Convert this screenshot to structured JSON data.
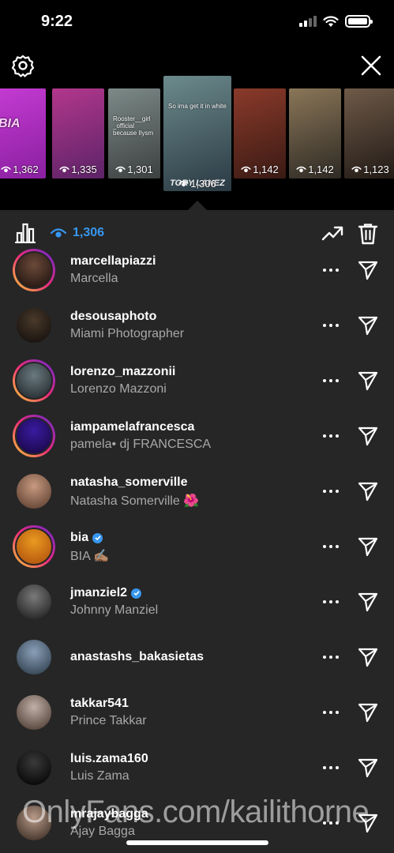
{
  "status_bar": {
    "time": "9:22"
  },
  "stories": [
    {
      "views": "1,362",
      "caption": "",
      "art": "BIA",
      "colors": [
        "#8a1fa0",
        "#c43bd2"
      ]
    },
    {
      "views": "1,335",
      "caption": "",
      "art": "",
      "colors": [
        "#5c2367",
        "#b2378c"
      ]
    },
    {
      "views": "1,301",
      "caption": "Rooster__girl _official because Ilysm",
      "art": "",
      "colors": [
        "#3c4040",
        "#7c8a88"
      ]
    },
    {
      "views": "1,306",
      "caption": "So ima get it in white",
      "art": "TORY LANEZ",
      "colors": [
        "#2a3a44",
        "#6c8a8c"
      ]
    },
    {
      "views": "1,142",
      "caption": "",
      "art": "",
      "colors": [
        "#3a1a14",
        "#8a3a2a"
      ]
    },
    {
      "views": "1,142",
      "caption": "",
      "art": "",
      "colors": [
        "#2e2a24",
        "#8a7658"
      ]
    },
    {
      "views": "1,123",
      "caption": "",
      "art": "",
      "colors": [
        "#221a16",
        "#6e5a48"
      ]
    }
  ],
  "toolbar": {
    "view_count": "1,306"
  },
  "viewers": [
    {
      "username": "marcellapiazzi",
      "fullname": "Marcella",
      "verified": false,
      "ring": true,
      "avatar_colors": [
        "#6b4a3a",
        "#2a1a14"
      ]
    },
    {
      "username": "desousaphoto",
      "fullname": "Miami Photographer",
      "verified": false,
      "ring": false,
      "avatar_colors": [
        "#4a3a2a",
        "#1a1410"
      ]
    },
    {
      "username": "lorenzo_mazzonii",
      "fullname": "Lorenzo Mazzoni",
      "verified": false,
      "ring": true,
      "avatar_colors": [
        "#6a7a80",
        "#2c3438"
      ]
    },
    {
      "username": "iampamelafrancesca",
      "fullname": "pamela• dj FRANCESCA",
      "verified": false,
      "ring": true,
      "avatar_colors": [
        "#3a1aa0",
        "#1c0a50"
      ]
    },
    {
      "username": "natasha_somerville",
      "fullname": "Natasha Somerville 🌺",
      "verified": false,
      "ring": false,
      "avatar_colors": [
        "#c89a80",
        "#6a4a3a"
      ]
    },
    {
      "username": "bia",
      "fullname": "BIA ✍🏽",
      "verified": true,
      "ring": true,
      "avatar_colors": [
        "#e89a20",
        "#b85a10"
      ]
    },
    {
      "username": "jmanziel2",
      "fullname": "Johnny Manziel",
      "verified": true,
      "ring": false,
      "avatar_colors": [
        "#7a7a7a",
        "#2a2a2a"
      ]
    },
    {
      "username": "anastashs_bakasietas",
      "fullname": "",
      "verified": false,
      "ring": false,
      "avatar_colors": [
        "#8aa0b8",
        "#3a4a5a"
      ]
    },
    {
      "username": "takkar541",
      "fullname": "Prince Takkar",
      "verified": false,
      "ring": false,
      "avatar_colors": [
        "#c0b0a8",
        "#5a4a40"
      ]
    },
    {
      "username": "luis.zama160",
      "fullname": "Luis Zama",
      "verified": false,
      "ring": false,
      "avatar_colors": [
        "#3a3a3a",
        "#0a0a0a"
      ]
    },
    {
      "username": "mrajaybagga",
      "fullname": "Ajay Bagga",
      "verified": false,
      "ring": false,
      "avatar_colors": [
        "#b89a88",
        "#4a3a30"
      ]
    }
  ],
  "watermark": "OnlyFans.com/kailithorne",
  "colors": {
    "accent": "#3797f0",
    "panel": "#262626",
    "muted": "#a8a8a8"
  }
}
